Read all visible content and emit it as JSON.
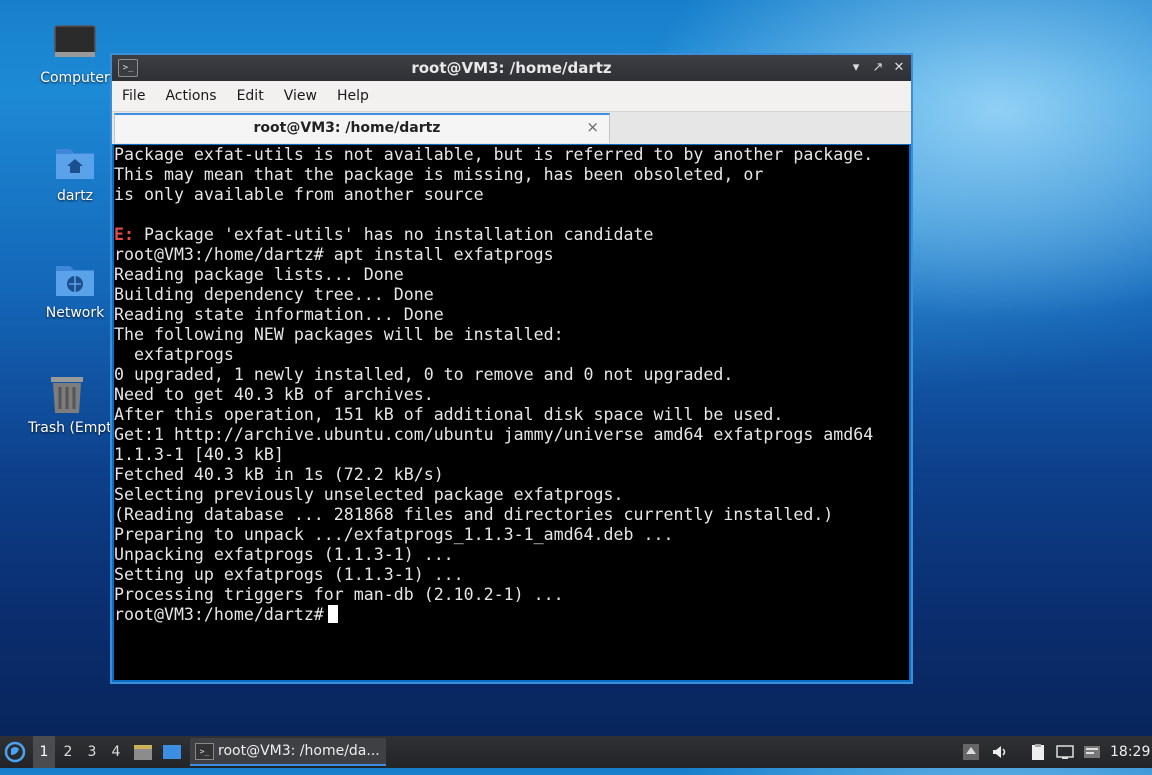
{
  "desktop": {
    "icons": [
      {
        "label": "Computer"
      },
      {
        "label": "dartz"
      },
      {
        "label": "Network"
      },
      {
        "label": "Trash (Empty)"
      }
    ]
  },
  "window": {
    "title": "root@VM3: /home/dartz",
    "menu": [
      "File",
      "Actions",
      "Edit",
      "View",
      "Help"
    ],
    "tab_label": "root@VM3: /home/dartz",
    "tab_close": "×",
    "icons": {
      "app": "terminal-icon",
      "minimize": "minimize-icon",
      "maximize": "maximize-icon",
      "close": "close-icon"
    }
  },
  "terminal": {
    "lines": [
      "Package exfat-utils is not available, but is referred to by another package.",
      "This may mean that the package is missing, has been obsoleted, or",
      "is only available from another source",
      "",
      "E: Package 'exfat-utils' has no installation candidate",
      "root@VM3:/home/dartz# apt install exfatprogs",
      "Reading package lists... Done",
      "Building dependency tree... Done",
      "Reading state information... Done",
      "The following NEW packages will be installed:",
      "  exfatprogs",
      "0 upgraded, 1 newly installed, 0 to remove and 0 not upgraded.",
      "Need to get 40.3 kB of archives.",
      "After this operation, 151 kB of additional disk space will be used.",
      "Get:1 http://archive.ubuntu.com/ubuntu jammy/universe amd64 exfatprogs amd64",
      "1.1.3-1 [40.3 kB]",
      "Fetched 40.3 kB in 1s (72.2 kB/s)",
      "Selecting previously unselected package exfatprogs.",
      "(Reading database ... 281868 files and directories currently installed.)",
      "Preparing to unpack .../exfatprogs_1.1.3-1_amd64.deb ...",
      "Unpacking exfatprogs (1.1.3-1) ...",
      "Setting up exfatprogs (1.1.3-1) ...",
      "Processing triggers for man-db (2.10.2-1) ..."
    ],
    "error_prefix": "E:",
    "error_rest": " Package 'exfat-utils' has no installation candidate",
    "prompt": "root@VM3:/home/dartz#",
    "colors": {
      "background": "#000000",
      "text": "#e6e6e6",
      "error": "#e8484a"
    }
  },
  "taskbar": {
    "workspaces": [
      "1",
      "2",
      "3",
      "4"
    ],
    "active_workspace": "1",
    "task_label": "root@VM3: /home/da...",
    "clock": "18:29",
    "icons": [
      "start-menu-icon",
      "file-manager-icon",
      "show-desktop-icon",
      "up-arrow-icon",
      "volume-icon",
      "clipboard-icon",
      "network-icon",
      "notification-icon"
    ]
  }
}
